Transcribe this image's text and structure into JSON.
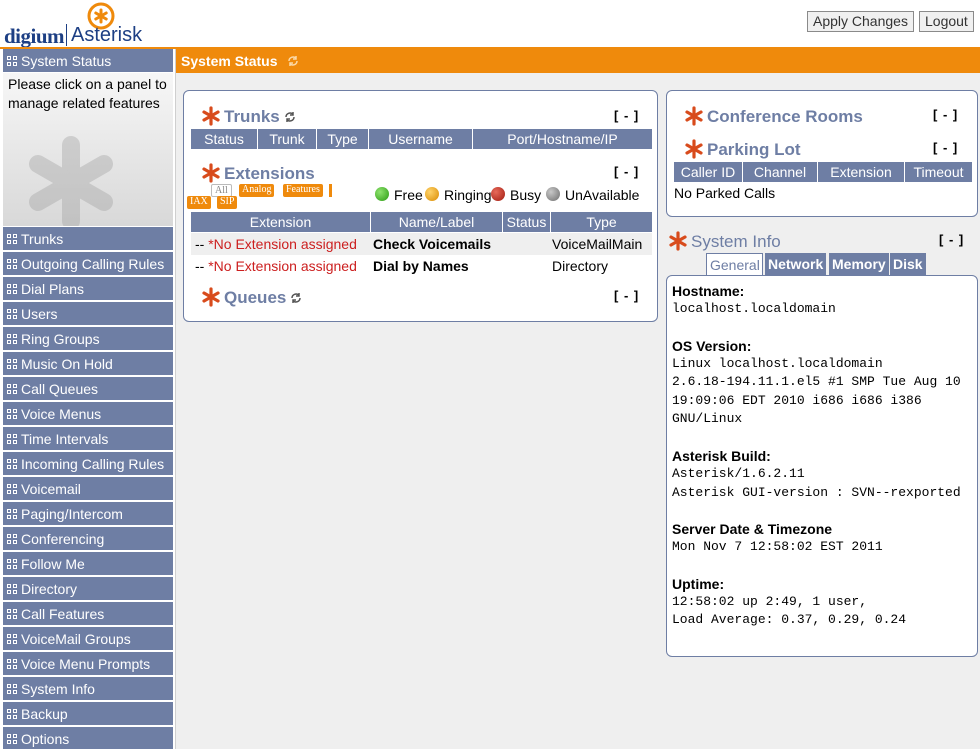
{
  "header": {
    "logo_left": "digium",
    "logo_right": "Asterisk",
    "apply_label": "Apply Changes",
    "logout_label": "Logout"
  },
  "sidebar": {
    "active_label": "System Status",
    "help_text": "Please click on a panel to manage related features",
    "items": [
      {
        "label": "Trunks"
      },
      {
        "label": "Outgoing Calling Rules"
      },
      {
        "label": "Dial Plans"
      },
      {
        "label": "Users"
      },
      {
        "label": "Ring Groups"
      },
      {
        "label": "Music On Hold"
      },
      {
        "label": "Call Queues"
      },
      {
        "label": "Voice Menus"
      },
      {
        "label": "Time Intervals"
      },
      {
        "label": "Incoming Calling Rules"
      },
      {
        "label": "Voicemail"
      },
      {
        "label": "Paging/Intercom"
      },
      {
        "label": "Conferencing"
      },
      {
        "label": "Follow Me"
      },
      {
        "label": "Directory"
      },
      {
        "label": "Call Features"
      },
      {
        "label": "VoiceMail Groups"
      },
      {
        "label": "Voice Menu Prompts"
      },
      {
        "label": "System Info"
      },
      {
        "label": "Backup"
      },
      {
        "label": "Options"
      }
    ]
  },
  "main": {
    "title": "System Status",
    "collapse_label": "[ - ]",
    "trunks": {
      "title": "Trunks",
      "columns": [
        "Status",
        "Trunk",
        "Type",
        "Username",
        "Port/Hostname/IP"
      ]
    },
    "extensions": {
      "title": "Extensions",
      "filters": {
        "all": "All",
        "analog": "Analog",
        "features": "Features",
        "iax": "IAX",
        "sip": "SIP"
      },
      "legend": {
        "free": "Free",
        "ringing": "Ringing",
        "busy": "Busy",
        "unavailable": "UnAvailable"
      },
      "columns": [
        "Extension",
        "Name/Label",
        "Status",
        "Type"
      ],
      "rows": [
        {
          "prefix": "--",
          "extension": "*No Extension assigned",
          "name": "Check Voicemails",
          "status": "",
          "type": "VoiceMailMain"
        },
        {
          "prefix": "--",
          "extension": "*No Extension assigned",
          "name": "Dial by Names",
          "status": "",
          "type": "Directory"
        }
      ]
    },
    "queues": {
      "title": "Queues"
    },
    "conference": {
      "title": "Conference Rooms"
    },
    "parking": {
      "title": "Parking Lot",
      "columns": [
        "Caller ID",
        "Channel",
        "Extension",
        "Timeout"
      ],
      "empty_text": "No Parked Calls"
    },
    "sysinfo": {
      "title": "System Info",
      "tabs": [
        "General",
        "Network",
        "Memory",
        "Disk"
      ],
      "hostname_label": "Hostname:",
      "hostname": "localhost.localdomain",
      "os_label": "OS Version:",
      "os_lines": [
        "Linux localhost.localdomain",
        "2.6.18-194.11.1.el5 #1 SMP Tue Aug 10",
        "19:09:06 EDT 2010 i686 i686 i386",
        "GNU/Linux"
      ],
      "build_label": "Asterisk Build:",
      "build_lines": [
        "Asterisk/1.6.2.11",
        "Asterisk GUI-version : SVN--rexported"
      ],
      "date_label": "Server Date & Timezone",
      "date": "Mon Nov 7 12:58:02 EST 2011",
      "uptime_label": "Uptime:",
      "uptime_lines": [
        "12:58:02 up 2:49, 1 user,",
        "Load Average: 0.37, 0.29, 0.24"
      ]
    }
  },
  "colors": {
    "accent_orange": "#ef8a0c",
    "nav_blue": "#6e7ea4",
    "no_extension_red": "#cc1f1f"
  }
}
